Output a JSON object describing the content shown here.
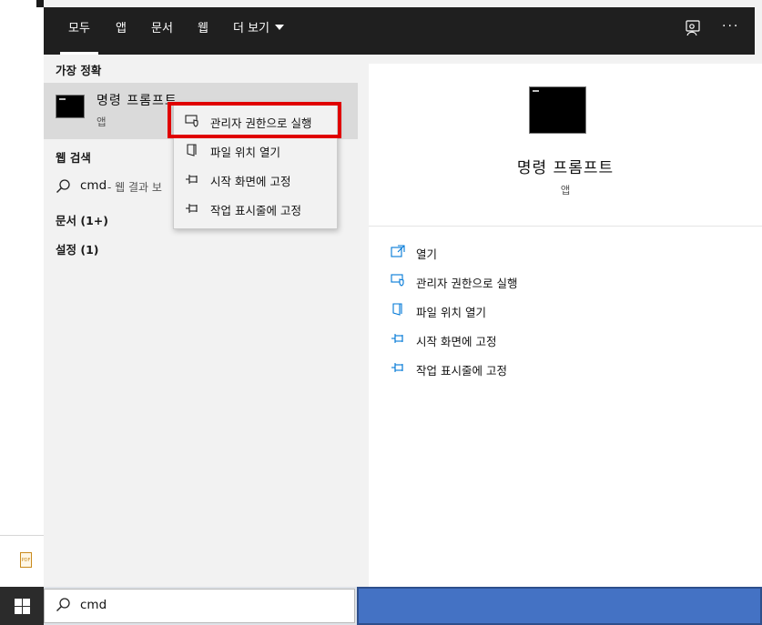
{
  "colors": {
    "accent": "#0078d7",
    "highlight_box": "#e00000",
    "taskbar_blue": "#4472c4"
  },
  "tabs": [
    {
      "label": "모두",
      "active": true
    },
    {
      "label": "앱"
    },
    {
      "label": "문서"
    },
    {
      "label": "웹"
    },
    {
      "label": "더 보기"
    }
  ],
  "header_icons": {
    "feedback": "feedback-person-icon",
    "options": "more-options-icon"
  },
  "left": {
    "best_match_title": "가장 정확",
    "best_match": {
      "title": "명령 프롬프트",
      "subtitle": "앱",
      "icon": "command-prompt-icon"
    },
    "web_search_title": "웹 검색",
    "web_search": {
      "query": "cmd",
      "suffix": "- 웹 결과 보",
      "icon": "search-icon"
    },
    "documents_label": "문서 (1+)",
    "settings_label": "설정 (1)"
  },
  "context_menu": [
    {
      "label": "관리자 권한으로 실행",
      "icon": "shield-icon"
    },
    {
      "label": "파일 위치 열기",
      "icon": "file-location-icon"
    },
    {
      "label": "시작 화면에 고정",
      "icon": "pin-icon"
    },
    {
      "label": "작업 표시줄에 고정",
      "icon": "pin-icon"
    }
  ],
  "detail": {
    "title": "명령 프롬프트",
    "subtitle": "앱",
    "actions": [
      {
        "label": "열기",
        "icon": "open-icon"
      },
      {
        "label": "관리자 권한으로 실행",
        "icon": "shield-icon"
      },
      {
        "label": "파일 위치 열기",
        "icon": "file-location-icon"
      },
      {
        "label": "시작 화면에 고정",
        "icon": "pin-icon"
      },
      {
        "label": "작업 표시줄에 고정",
        "icon": "pin-icon"
      }
    ]
  },
  "taskbar": {
    "search_value": "cmd",
    "start_icon": "windows-logo-icon",
    "search_icon": "search-icon"
  },
  "background_icons": {
    "pdf": "pdf-file-icon",
    "pdf_label": "PDF"
  }
}
